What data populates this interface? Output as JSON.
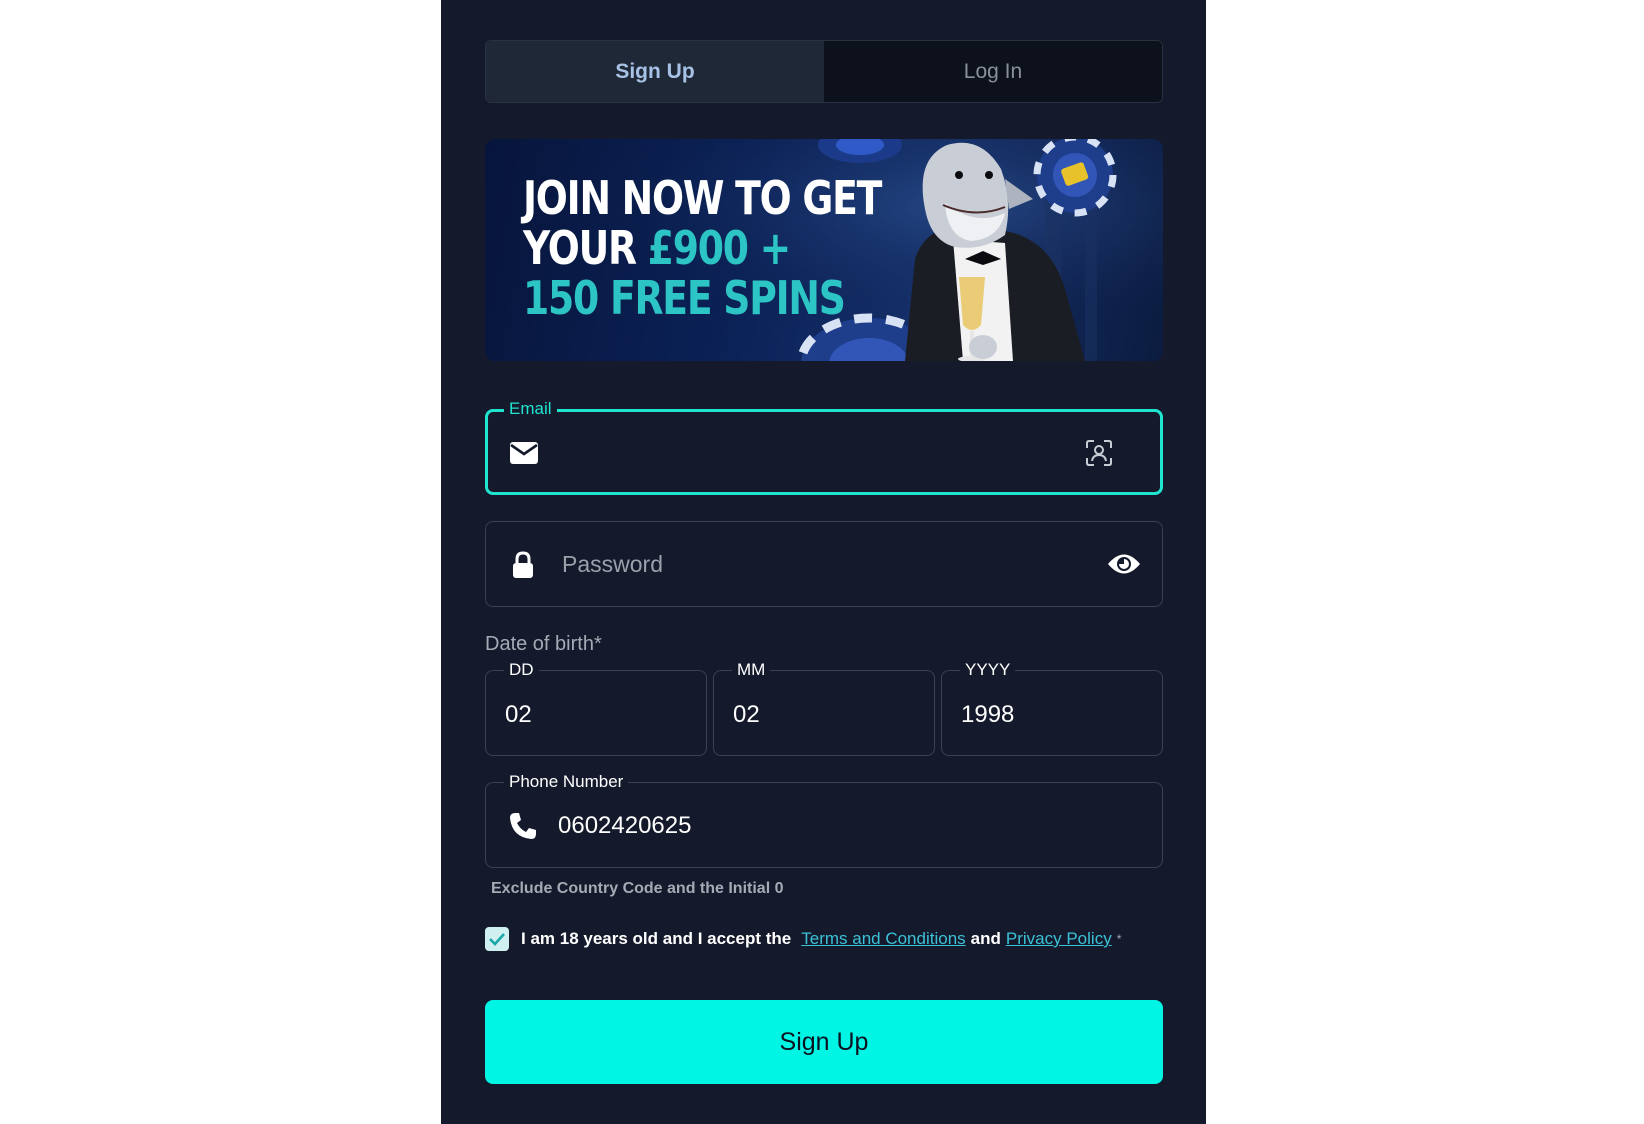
{
  "tabs": [
    {
      "label": "Sign Up",
      "active": true
    },
    {
      "label": "Log In",
      "active": false
    }
  ],
  "banner": {
    "line1": "JOIN NOW TO GET",
    "line2_white": "YOUR ",
    "line2_teal": "£900 +",
    "line3": "150 FREE SPINS"
  },
  "email": {
    "label": "Email",
    "value": "",
    "icon": "envelope-icon",
    "right_icon": "face-scan-icon"
  },
  "password": {
    "placeholder": "Password",
    "icon": "lock-icon",
    "toggle_icon": "eye-icon"
  },
  "dob": {
    "label": "Date of birth*",
    "day": {
      "label": "DD",
      "value": "02"
    },
    "month": {
      "label": "MM",
      "value": "02"
    },
    "year": {
      "label": "YYYY",
      "value": "1998"
    }
  },
  "phone": {
    "label": "Phone Number",
    "value": "0602420625",
    "hint": "Exclude Country Code and the Initial 0",
    "icon": "phone-icon"
  },
  "terms": {
    "checked": true,
    "prefix": "I am 18 years old and I accept the",
    "terms_link": "Terms and Conditions",
    "and": "and",
    "privacy_link": "Privacy Policy",
    "required_mark": "*"
  },
  "submit_label": "Sign Up",
  "colors": {
    "panel_bg": "#141a2b",
    "accent": "#00f5e4",
    "focus_border": "#20e3d0",
    "link": "#3cc1d6",
    "banner_teal": "#2cc4c4"
  }
}
